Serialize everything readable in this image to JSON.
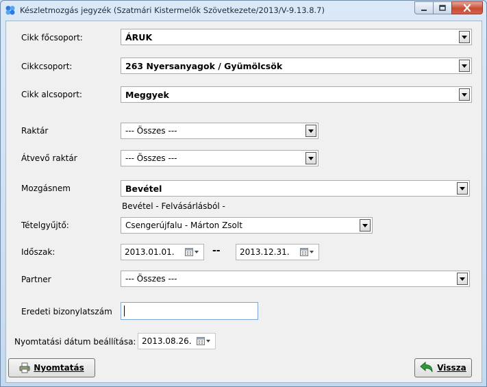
{
  "window": {
    "title": "Készletmozgás jegyzék (Szatmári Kistermelők Szövetkezete/2013/V-9.13.8.7)"
  },
  "form": {
    "main_group": {
      "label": "Cikk főcsoport:",
      "value": "ÁRUK"
    },
    "group": {
      "label": "Cikkcsoport:",
      "value": "263  Nyersanyagok / Gyümölcsök"
    },
    "subgroup": {
      "label": "Cikk alcsoport:",
      "value": "Meggyek"
    },
    "warehouse": {
      "label": "Raktár",
      "value": "--- Összes ---"
    },
    "receiving_warehouse": {
      "label": "Átvevő raktár",
      "value": "--- Összes ---"
    },
    "movement_type": {
      "label": "Mozgásnem",
      "value": "Bevétel",
      "subtext": "Bevétel - Felvásárlásból -"
    },
    "item_collector": {
      "label": "Tételgyűjtő:",
      "value": "Csengerújfalu - Márton Zsolt"
    },
    "period": {
      "label": "Időszak:",
      "from": "2013.01.01.",
      "separator": "--",
      "to": "2013.12.31."
    },
    "partner": {
      "label": "Partner",
      "value": "--- Összes ---"
    },
    "original_doc_number": {
      "label": "Eredeti bizonylatszám",
      "value": ""
    },
    "print_date": {
      "label": "Nyomtatási dátum beállítása:",
      "value": "2013.08.26."
    }
  },
  "buttons": {
    "print": "Nyomtatás",
    "back": "Vissza"
  },
  "icons": {
    "app": "app-logo-icon",
    "printer": "printer-icon",
    "back": "back-arrow-icon",
    "calendar": "calendar-icon",
    "dropdown": "chevron-down-icon"
  }
}
